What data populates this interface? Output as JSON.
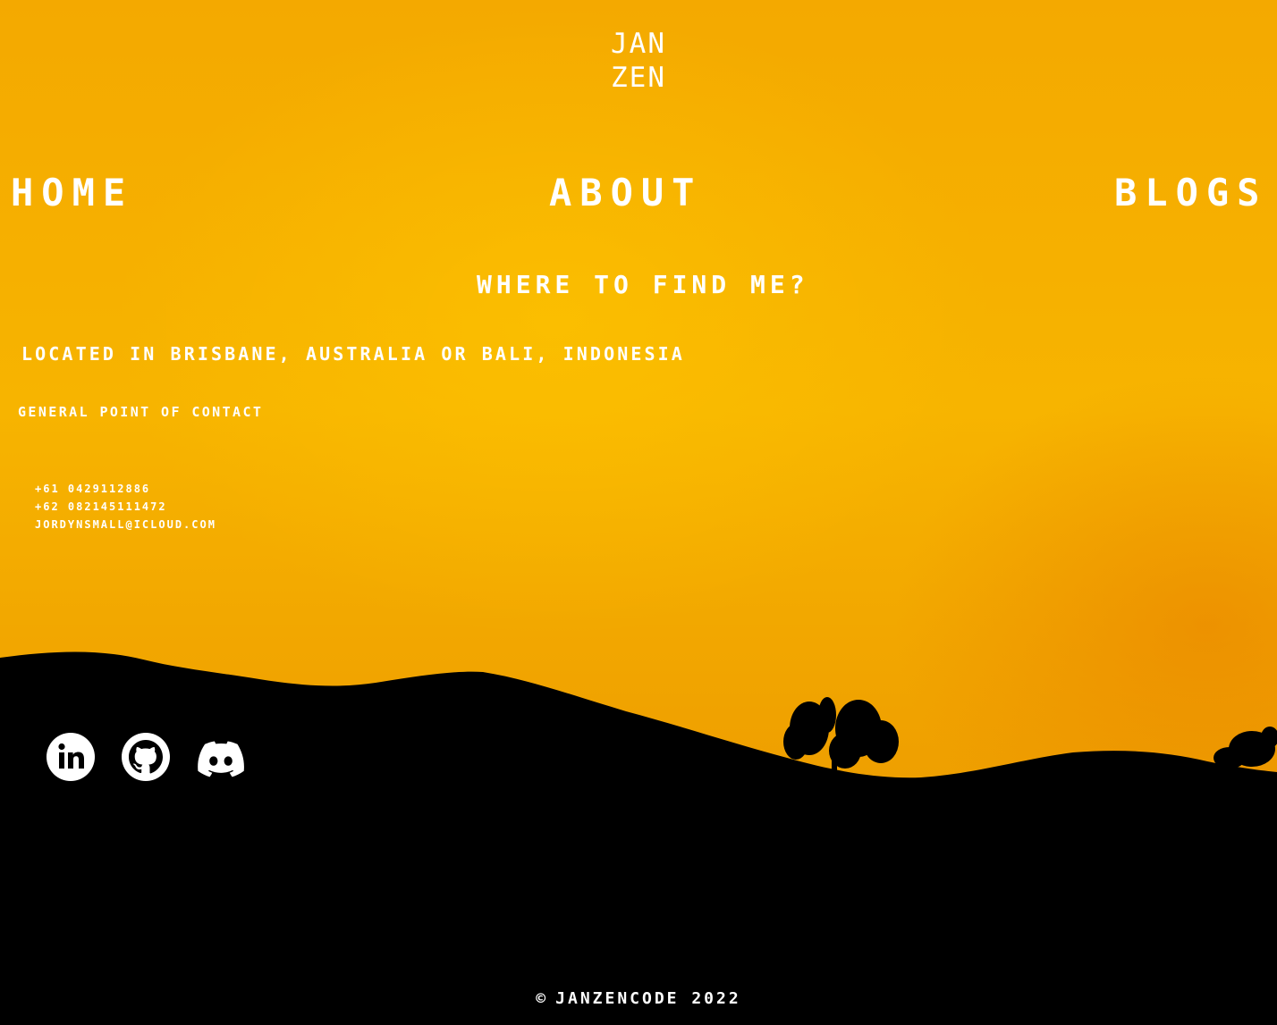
{
  "logo": {
    "line1": "JAN",
    "line2": "ZEN"
  },
  "nav": {
    "home": "HOME",
    "about": "ABOUT",
    "blogs": "BLOGS"
  },
  "main": {
    "heading": "WHERE TO FIND ME?",
    "location": "LOCATED IN BRISBANE, AUSTRALIA OR BALI, INDONESIA",
    "contact_title": "GENERAL POINT OF CONTACT",
    "phone_au": "+61 0429112886",
    "phone_id": "+62 082145111472",
    "email": "JORDYNSMALL@ICLOUD.COM"
  },
  "socials": [
    {
      "icon": "linkedin-icon"
    },
    {
      "icon": "github-icon"
    },
    {
      "icon": "discord-icon"
    }
  ],
  "footer": {
    "copyright_symbol": "©",
    "text": "JANZENCODE 2022"
  },
  "colors": {
    "sky": "#f5a800",
    "silhouette": "#000000",
    "text": "#ffffff"
  }
}
